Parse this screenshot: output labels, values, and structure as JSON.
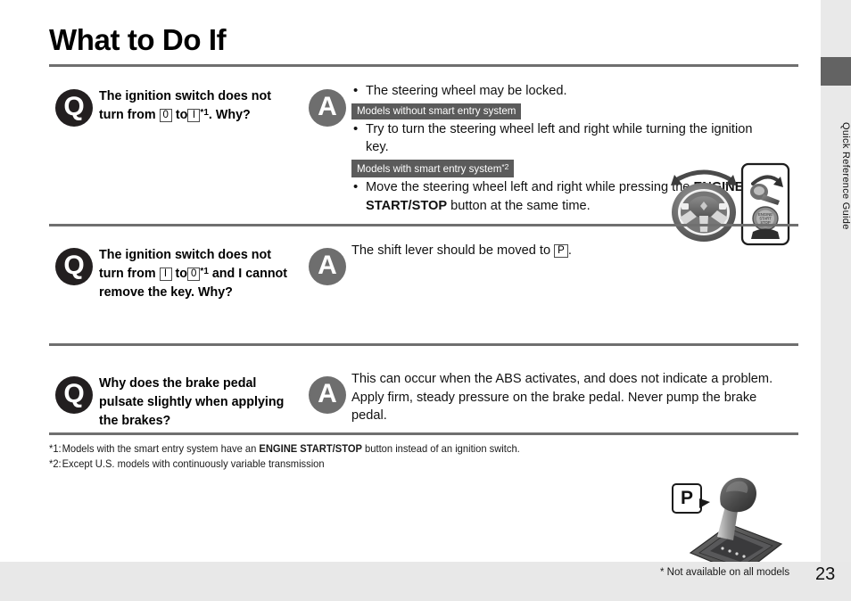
{
  "page": {
    "title": "What to Do If",
    "number": "23",
    "footer_note": "* Not available on all models",
    "side_tab_label": "Quick Reference Guide"
  },
  "qa": [
    {
      "q_badge": "Q",
      "a_badge": "A",
      "question_parts": {
        "line_a": "The ignition switch does",
        "line_b_pre": "not turn from",
        "key_from": "0",
        "line_b_mid": "to",
        "key_to": "I",
        "footnote_mark": "*1",
        "line_b_post": ".",
        "line_c": "Why?"
      },
      "answer_bullets": [
        "The steering wheel may be locked.",
        "Try to turn the steering wheel left and right while turning the ignition key.",
        "Move the steering wheel left and right while pressing the ENGINE START/STOP button at the same time."
      ],
      "chip_without": "Models without smart entry system",
      "chip_with": "Models with smart entry system",
      "chip_with_sup": "*2",
      "bullet3_pre": "Move the steering wheel left and right while pressing the",
      "bullet3_bold": "ENGINE START/STOP",
      "bullet3_post": "button at the same time.",
      "illustration": "steering-wheel-smart-entry-illustration"
    },
    {
      "q_badge": "Q",
      "a_badge": "A",
      "question_parts": {
        "line_a": "The ignition switch does",
        "line_b_pre": "not turn from",
        "key_from": "I",
        "line_b_mid": "to",
        "key_to": "0",
        "footnote_mark": "*1",
        "line_c": "and I cannot remove the",
        "line_d": "key. Why?"
      },
      "answer_pre": "The shift lever should be moved to",
      "answer_key": "P",
      "answer_post": ".",
      "illustration": "shift-lever-illustration",
      "callout": "P"
    },
    {
      "q_badge": "Q",
      "a_badge": "A",
      "question_parts": {
        "line_a": "Why does the brake pedal",
        "line_b": "pulsate slightly when",
        "line_c": "applying the brakes?"
      },
      "answer_text": "This can occur when the ABS activates, and does not indicate a problem. Apply firm, steady pressure on the brake pedal. Never pump the brake pedal."
    }
  ],
  "footnotes": [
    {
      "label": "*1:",
      "pre": "Models with the smart entry system have an ",
      "bold": "ENGINE START/STOP",
      "post": " button instead of an ignition switch."
    },
    {
      "label": "*2:",
      "pre": "Except U.S. models with continuously variable transmission",
      "bold": "",
      "post": ""
    }
  ],
  "colors": {
    "q_badge": "#231f20",
    "a_badge": "#6e6e6e",
    "chip": "#5b5b5b",
    "rule": "#6f6f6f",
    "footer_band": "#e8e8e8",
    "side_strip": "#e9e9e9",
    "side_tab": "#636363"
  }
}
